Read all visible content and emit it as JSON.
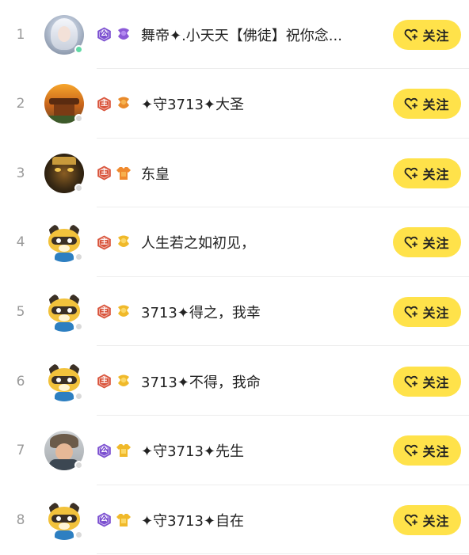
{
  "follow_label": "关注",
  "colors": {
    "accent_button": "#ffe24a",
    "badge_purple": "#7b4fd0",
    "badge_red": "#d9533a",
    "online_dot": "#62d9a6",
    "offline_dot": "#d9d9d9"
  },
  "rows": [
    {
      "rank": "1",
      "avatar": "fairy",
      "online": true,
      "role_badge": "公",
      "role_color": "purple",
      "fan_badge": "purple",
      "name": "舞帝✦.小天天【佛徒】祝你念..."
    },
    {
      "rank": "2",
      "avatar": "temple",
      "online": false,
      "role_badge": "主",
      "role_color": "red",
      "fan_badge": "orange",
      "name": "✦守3713✦大圣"
    },
    {
      "rank": "3",
      "avatar": "mask",
      "online": false,
      "role_badge": "主",
      "role_color": "red",
      "fan_badge": "orange-shirt",
      "name": "东皇"
    },
    {
      "rank": "4",
      "avatar": "raccoon",
      "online": false,
      "role_badge": "主",
      "role_color": "red",
      "fan_badge": "yellow",
      "name": "人生若之如初见，"
    },
    {
      "rank": "5",
      "avatar": "raccoon",
      "online": false,
      "role_badge": "主",
      "role_color": "red",
      "fan_badge": "yellow",
      "name": "3713✦得之，我幸"
    },
    {
      "rank": "6",
      "avatar": "raccoon",
      "online": false,
      "role_badge": "主",
      "role_color": "red",
      "fan_badge": "yellow",
      "name": "3713✦不得，我命"
    },
    {
      "rank": "7",
      "avatar": "man",
      "online": false,
      "role_badge": "公",
      "role_color": "purple",
      "fan_badge": "yellow-shirt",
      "name": "✦守3713✦先生"
    },
    {
      "rank": "8",
      "avatar": "raccoon",
      "online": false,
      "role_badge": "公",
      "role_color": "purple",
      "fan_badge": "yellow-shirt",
      "name": "✦守3713✦自在"
    }
  ]
}
